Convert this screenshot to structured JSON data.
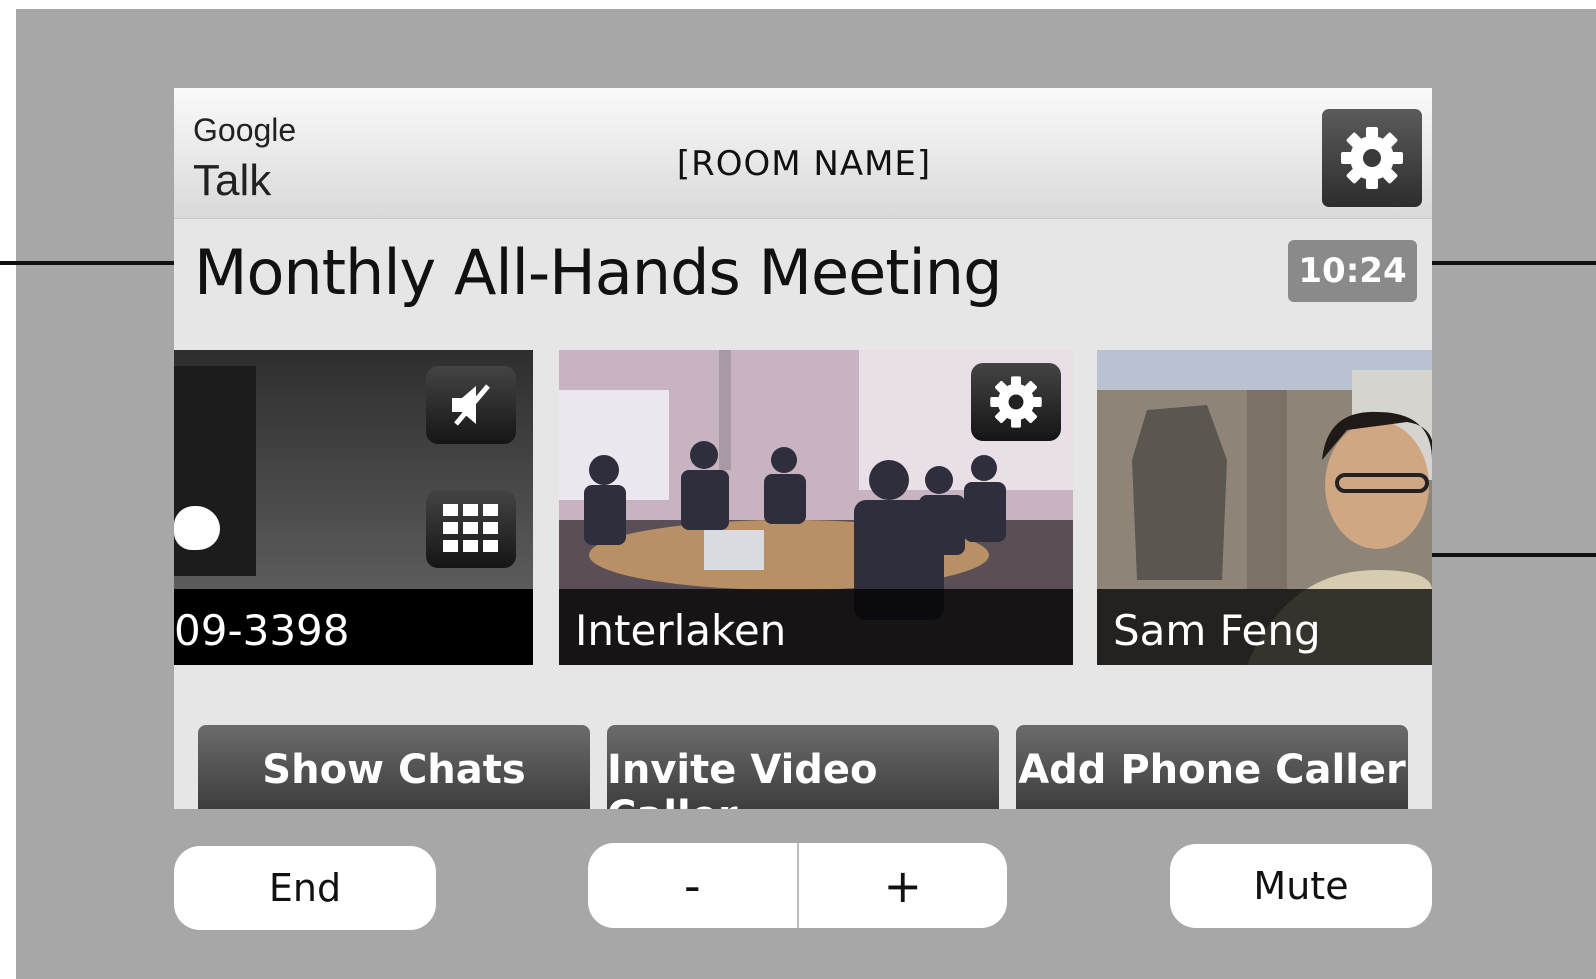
{
  "app": {
    "brand_line1": "Google",
    "brand_line2": "Talk",
    "room_name": "[ROOM NAME]"
  },
  "meeting": {
    "title": "Monthly All-Hands Meeting",
    "elapsed": "10:24"
  },
  "participants": [
    {
      "label": "09-3398"
    },
    {
      "label": "Interlaken"
    },
    {
      "label": "Sam Feng"
    }
  ],
  "actions": {
    "show_chats": "Show Chats",
    "invite_video": "Invite Video Caller",
    "add_phone": "Add Phone Caller"
  },
  "controls": {
    "end": "End",
    "volume_down": "-",
    "volume_up": "+",
    "mute": "Mute"
  },
  "icons": {
    "settings": "gear-icon",
    "speaker_muted": "speaker-muted-icon",
    "keypad": "keypad-icon"
  }
}
